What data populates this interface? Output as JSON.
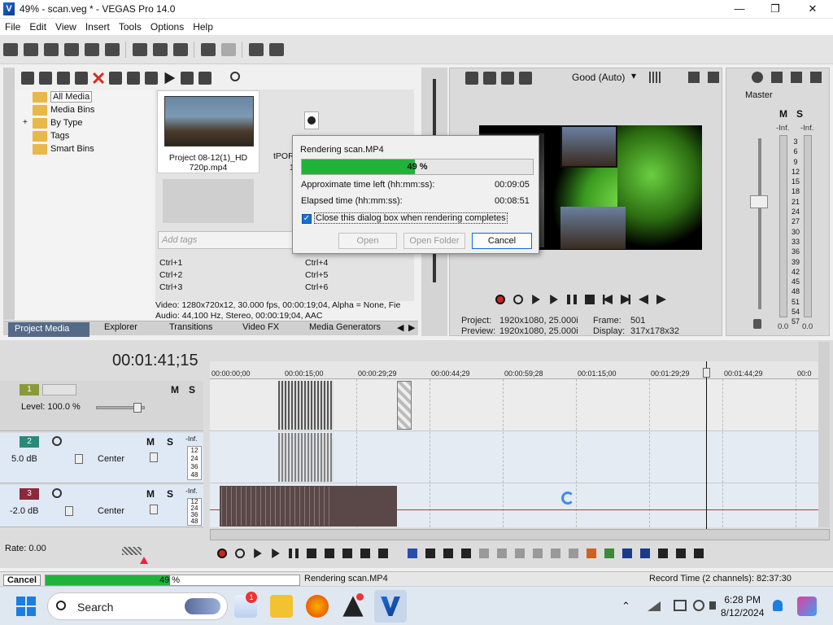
{
  "window": {
    "title": "49% - scan.veg * - VEGAS Pro 14.0",
    "logo_letter": "V"
  },
  "menu": [
    "File",
    "Edit",
    "View",
    "Insert",
    "Tools",
    "Options",
    "Help"
  ],
  "media_tree": {
    "items": [
      "All Media",
      "Media Bins",
      "By Type",
      "Tags",
      "Smart Bins"
    ],
    "expand_glyph": "+"
  },
  "media": {
    "clip1_label": "Project 08-12(1)_HD 720p.mp4",
    "clip2_label": "tPOR",
    "clip2_sub": "1",
    "tags_placeholder": "Add tags",
    "shortcuts": [
      "Ctrl+1",
      "Ctrl+2",
      "Ctrl+3",
      "Ctrl+4",
      "Ctrl+5",
      "Ctrl+6"
    ],
    "info_video": "Video: 1280x720x12, 30.000 fps, 00:00:19;04, Alpha = None, Fie",
    "info_audio": "Audio: 44,100 Hz, Stereo, 00:00:19;04, AAC"
  },
  "tabs_left": [
    "Project Media",
    "Explorer",
    "Transitions",
    "Video FX",
    "Media Generators"
  ],
  "preview": {
    "quality": "Good (Auto)",
    "project_label": "Project:",
    "project_value": "1920x1080, 25.000i",
    "preview_label": "Preview:",
    "preview_value": "1920x1080, 25.000i",
    "frame_label": "Frame:",
    "frame_value": "501",
    "display_label": "Display:",
    "display_value": "317x178x32"
  },
  "master": {
    "title": "Master",
    "m_label": "M",
    "s_label": "S",
    "inf_left": "-Inf.",
    "inf_right": "-Inf.",
    "scale": [
      "3",
      "6",
      "9",
      "12",
      "15",
      "18",
      "21",
      "24",
      "27",
      "30",
      "33",
      "36",
      "39",
      "42",
      "45",
      "48",
      "51",
      "54",
      "57"
    ],
    "val_left": "0.0",
    "val_right": "0.0"
  },
  "dialog": {
    "title": "Rendering scan.MP4",
    "progress_percent": 49,
    "progress_text": "49 %",
    "time_left_label": "Approximate time left (hh:mm:ss):",
    "time_left_value": "00:09:05",
    "elapsed_label": "Elapsed time (hh:mm:ss):",
    "elapsed_value": "00:08:51",
    "checkbox_label": "Close this dialog box when rendering completes",
    "checkbox_checked": true,
    "open_label": "Open",
    "open_folder_label": "Open Folder",
    "cancel_label": "Cancel"
  },
  "timeline": {
    "timecode": "00:01:41;15",
    "ruler": [
      "00:00:00;00",
      "00:00:15;00",
      "00:00:29;29",
      "00:00:44;29",
      "00:00:59;28",
      "00:01:15;00",
      "00:01:29;29",
      "00:01:44;29",
      "00:0"
    ],
    "tracks": [
      {
        "num": "1",
        "type": "video",
        "level_label": "Level: 100.0 %",
        "color": "#8a9a3a"
      },
      {
        "num": "2",
        "type": "audio",
        "volume": "5.0 dB",
        "pan": "Center",
        "color": "#2a8a7a",
        "inf": "-Inf.",
        "meter_scale": [
          "12",
          "24",
          "36",
          "48"
        ]
      },
      {
        "num": "3",
        "type": "audio",
        "volume": "-2.0 dB",
        "pan": "Center",
        "color": "#8a2a3a",
        "inf": "-Inf.",
        "meter_scale": [
          "12",
          "24",
          "36",
          "48"
        ]
      }
    ],
    "m_label": "M",
    "s_label": "S",
    "rate": "Rate: 0.00"
  },
  "status": {
    "cancel_label": "Cancel",
    "progress_percent": 49,
    "progress_text": "49 %",
    "message": "Rendering scan.MP4",
    "record_time": "Record Time (2 channels): 82:37:30"
  },
  "taskbar": {
    "search_label": "Search",
    "time": "6:28 PM",
    "date": "8/12/2024",
    "notification_badge": "1"
  },
  "colors": {
    "accent": "#1a6fd6",
    "progress": "#1fb33a",
    "tab_active": "#556a86"
  }
}
